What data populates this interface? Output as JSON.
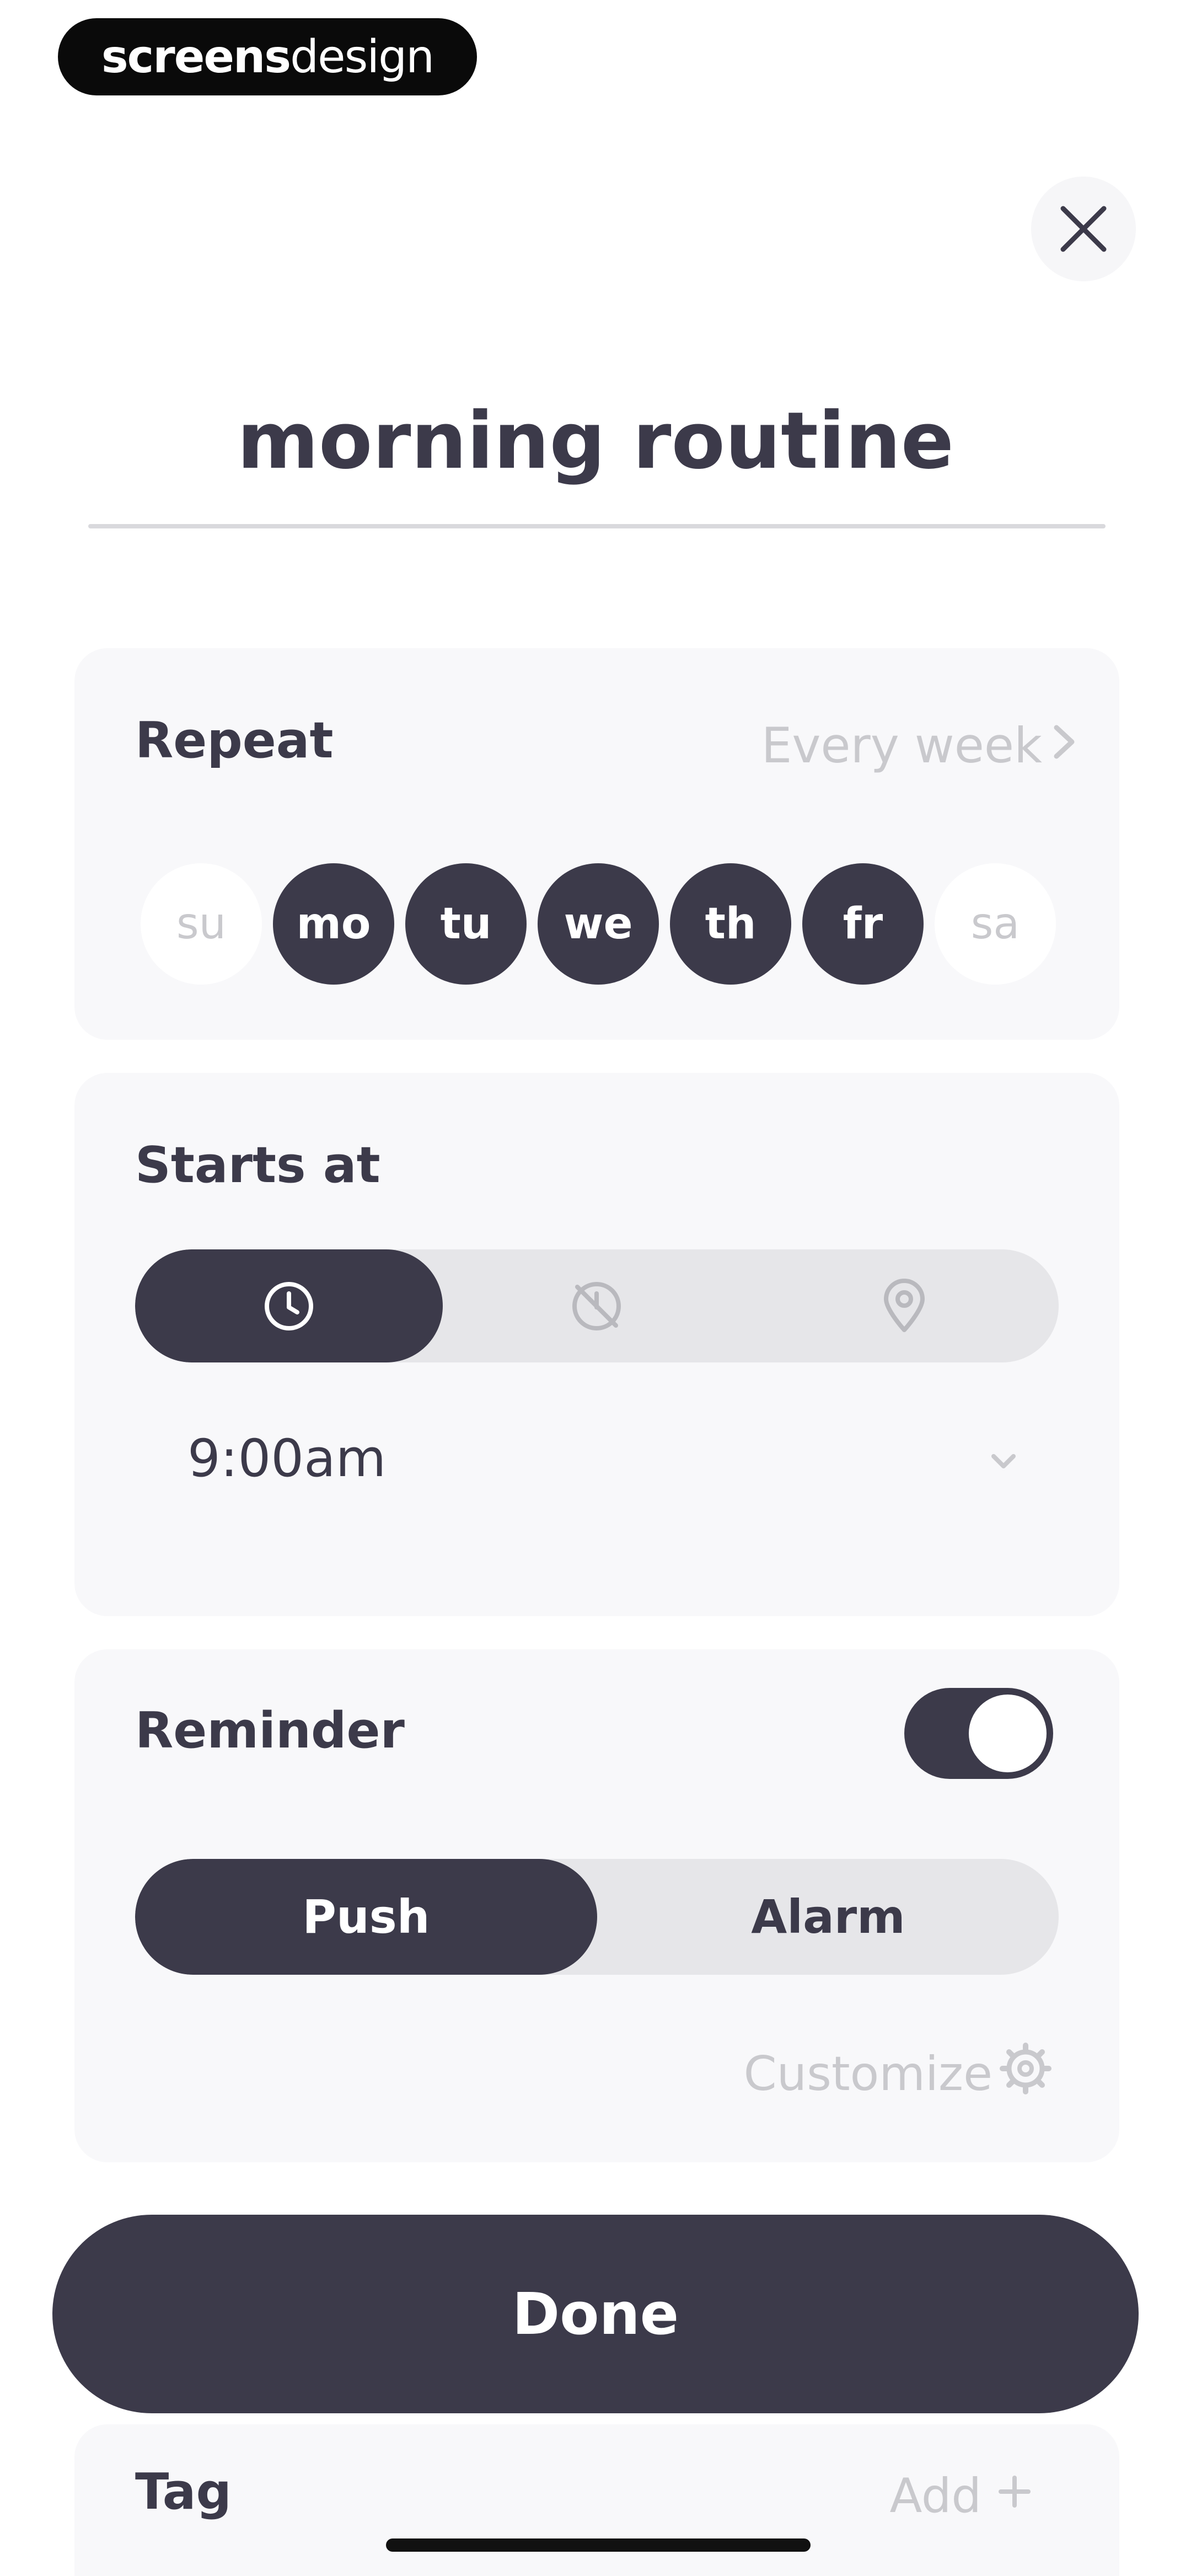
{
  "watermark": {
    "part1": "screens",
    "part2": "design"
  },
  "title": "morning routine",
  "repeat": {
    "label": "Repeat",
    "value": "Every week",
    "days": [
      {
        "label": "su",
        "selected": false
      },
      {
        "label": "mo",
        "selected": true
      },
      {
        "label": "tu",
        "selected": true
      },
      {
        "label": "we",
        "selected": true
      },
      {
        "label": "th",
        "selected": true
      },
      {
        "label": "fr",
        "selected": true
      },
      {
        "label": "sa",
        "selected": false
      }
    ]
  },
  "starts_at": {
    "label": "Starts at",
    "modes": [
      {
        "icon": "clock-icon",
        "selected": true
      },
      {
        "icon": "no-time-icon",
        "selected": false
      },
      {
        "icon": "location-pin-icon",
        "selected": false
      }
    ],
    "time": "9:00am"
  },
  "reminder": {
    "label": "Reminder",
    "enabled": true,
    "channels": [
      {
        "label": "Push",
        "selected": true
      },
      {
        "label": "Alarm",
        "selected": false
      }
    ],
    "customize_label": "Customize"
  },
  "done_label": "Done",
  "tag": {
    "label": "Tag",
    "add_label": "Add"
  },
  "colors": {
    "primary": "#3c3a4a",
    "muted": "#c9c9cd",
    "card": "#f8f8fa",
    "segment_track": "#e6e6e9"
  }
}
